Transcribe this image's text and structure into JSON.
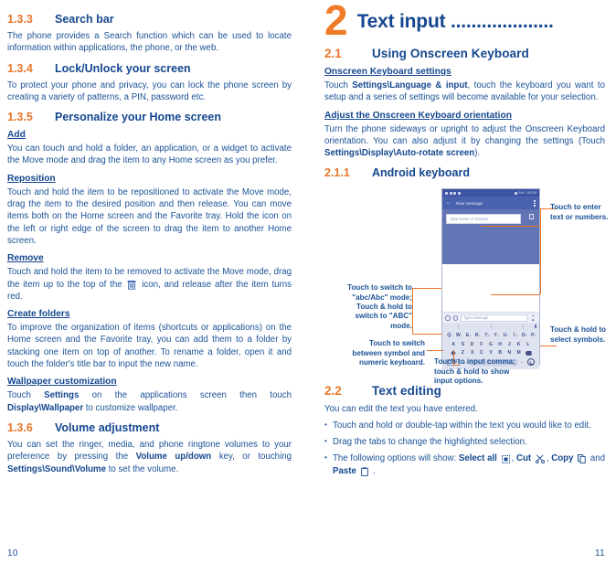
{
  "colors": {
    "heading_blue": "#14478F",
    "body_blue": "#1B5296",
    "accent_orange": "#E8762B",
    "chapter_orange": "#F07C2B",
    "phone_appbar": "#4a61ad",
    "phone_status": "#3c53a4",
    "keyboard_bg": "#dfe3f0"
  },
  "left_column": {
    "sections": [
      {
        "number": "1.3.3",
        "title": "Search bar",
        "paragraphs": [
          "The phone provides a Search function which can be used to locate information within applications, the phone, or the web."
        ]
      },
      {
        "number": "1.3.4",
        "title": "Lock/Unlock your screen",
        "paragraphs": [
          "To protect your phone and privacy, you can lock the phone screen by creating a variety of patterns, a PIN, password etc."
        ]
      },
      {
        "number": "1.3.5",
        "title": "Personalize your Home screen"
      }
    ],
    "subsections": [
      {
        "heading": "Add",
        "body": "You can touch and hold a folder, an application, or a widget to activate the Move mode and drag the item to any Home screen as you prefer."
      },
      {
        "heading": "Reposition ",
        "body": "Touch and hold the item to be repositioned to activate the Move mode, drag the item to the desired position and then release. You can move items both on the Home screen and the Favorite tray. Hold the icon on the left or right edge of the screen to drag the item to another Home screen."
      },
      {
        "heading": "Remove",
        "body_before_icon": "Touch and hold the item to be removed to activate the Move mode, drag the item up to the top of the ",
        "icon": "trash-icon",
        "body_after_icon": " icon, and release after the item turns red."
      },
      {
        "heading": "Create folders",
        "body": "To improve the organization of items (shortcuts or applications) on the Home screen and the Favorite tray, you can add them to a folder by stacking one item on top of another. To  rename a folder, open it and touch the folder's title bar to input the new name."
      },
      {
        "heading": "Wallpaper customization",
        "body_parts": [
          {
            "text": "Touch ",
            "bold": false
          },
          {
            "text": "Settings",
            "bold": true
          },
          {
            "text": " on the applications screen then touch ",
            "bold": false
          },
          {
            "text": "Display\\Wallpaper",
            "bold": true
          },
          {
            "text": " to customize wallpaper.",
            "bold": false
          }
        ]
      }
    ],
    "volume_section": {
      "number": "1.3.6",
      "title": "Volume adjustment",
      "body_parts": [
        {
          "text": "You can set the ringer, media, and phone ringtone volumes to your preference by pressing the ",
          "bold": false
        },
        {
          "text": "Volume up/down",
          "bold": true
        },
        {
          "text": " key, or touching ",
          "bold": false
        },
        {
          "text": "Settings\\Sound\\Volume",
          "bold": true
        },
        {
          "text": " to set the volume.",
          "bold": false
        }
      ]
    },
    "page_number": "10"
  },
  "right_column": {
    "chapter": {
      "number": "2",
      "title": "Text input ...................."
    },
    "section_2_1": {
      "number": "2.1",
      "title": "Using Onscreen Keyboard",
      "sub1_heading": "Onscreen Keyboard settings",
      "sub1_parts": [
        {
          "text": "Touch ",
          "bold": false
        },
        {
          "text": "Settings\\Language & input",
          "bold": true
        },
        {
          "text": ", touch the keyboard you want to setup and a series of settings will become available for your selection.",
          "bold": false
        }
      ],
      "sub2_heading": "Adjust the Onscreen Keyboard orientation",
      "sub2_parts": [
        {
          "text": "Turn the phone sideways or upright to adjust the Onscreen Keyboard orientation. You can also adjust it by changing the settings (Touch ",
          "bold": false
        },
        {
          "text": "Settings\\Display\\Auto-rotate screen",
          "bold": true
        },
        {
          "text": ").",
          "bold": false
        }
      ]
    },
    "section_2_1_1": {
      "number": "2.1.1",
      "title": "Android keyboard"
    },
    "phone": {
      "status_time": "1:16 PM",
      "status_battery": "34%",
      "appbar_title": "New message",
      "recipient_placeholder": "Type Name or Number",
      "composer_placeholder": "Type message",
      "keyboard_rows": [
        [
          {
            "key": "Q",
            "sup": "1"
          },
          {
            "key": "W",
            "sup": "2"
          },
          {
            "key": "E",
            "sup": "3"
          },
          {
            "key": "R",
            "sup": "4"
          },
          {
            "key": "T",
            "sup": "5"
          },
          {
            "key": "Y",
            "sup": "6"
          },
          {
            "key": "U",
            "sup": "7"
          },
          {
            "key": "I",
            "sup": "8"
          },
          {
            "key": "O",
            "sup": "9"
          },
          {
            "key": "P",
            "sup": "0"
          }
        ],
        [
          {
            "key": "A"
          },
          {
            "key": "S"
          },
          {
            "key": "D"
          },
          {
            "key": "F"
          },
          {
            "key": "G"
          },
          {
            "key": "H"
          },
          {
            "key": "J"
          },
          {
            "key": "K"
          },
          {
            "key": "L"
          }
        ],
        [
          {
            "key": "Z"
          },
          {
            "key": "X"
          },
          {
            "key": "C"
          },
          {
            "key": "V"
          },
          {
            "key": "B"
          },
          {
            "key": "N"
          },
          {
            "key": "M"
          }
        ]
      ],
      "symbol_key_label": "?123",
      "comma_key_label": ","
    },
    "callouts": {
      "enter_text": "Touch to enter\ntext or numbers.",
      "select_symbols": "Touch & hold to\nselect symbols.",
      "switch_case": "Touch to switch to\n\"abc/Abc\" mode;\nTouch & hold to\nswitch to \"ABC\"\nmode.",
      "switch_numeric": "Touch to switch\nbetween symbol and\nnumeric keyboard.",
      "input_comma": "Touch to input comma;\ntouch & hold to show\ninput options."
    },
    "section_2_2": {
      "number": "2.2",
      "title": "Text editing",
      "intro": "You can edit the text you have entered.",
      "bullets": [
        {
          "text": "Touch and hold or double-tap within the text you would like to edit."
        },
        {
          "text": "Drag the tabs to change the highlighted selection."
        }
      ],
      "options_bullet": {
        "lead": "The following options will show: ",
        "items": [
          {
            "label": "Select all",
            "icon": "select-all-icon"
          },
          {
            "label": "Cut",
            "icon": "scissors-icon"
          },
          {
            "label": "Copy",
            "icon": "copy-icon"
          },
          {
            "label": "Paste",
            "icon": "paste-icon"
          }
        ],
        "separator": ", ",
        "conjunction": " and ",
        "tail": " ."
      }
    },
    "page_number": "11"
  }
}
